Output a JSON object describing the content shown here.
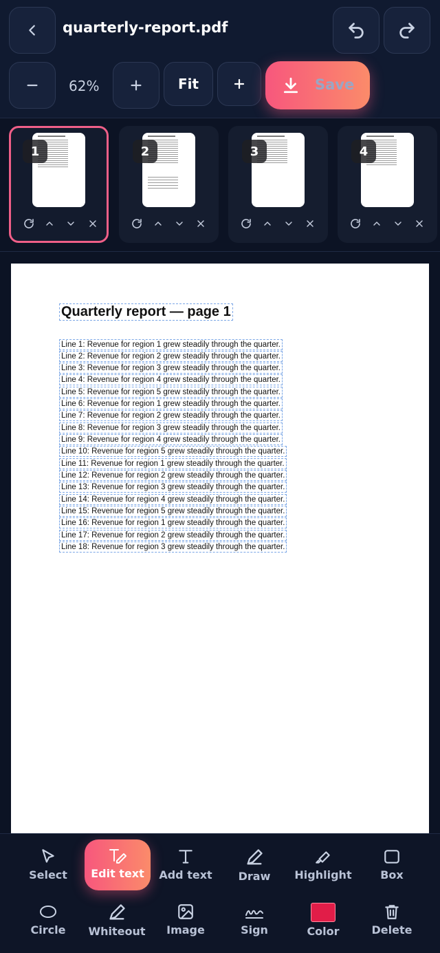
{
  "header": {
    "title": "quarterly-report.pdf",
    "zoom": "62%",
    "fit_label": "Fit",
    "save_label": "Save"
  },
  "pages": [
    {
      "number": "1",
      "selected": true
    },
    {
      "number": "2",
      "selected": false
    },
    {
      "number": "3",
      "selected": false
    },
    {
      "number": "4",
      "selected": false
    }
  ],
  "document": {
    "title": "Quarterly report — page 1",
    "lines": [
      "Line 1: Revenue for region 1 grew steadily through the quarter.",
      "Line 2: Revenue for region 2 grew steadily through the quarter.",
      "Line 3: Revenue for region 3 grew steadily through the quarter.",
      "Line 4: Revenue for region 4 grew steadily through the quarter.",
      "Line 5: Revenue for region 5 grew steadily through the quarter.",
      "Line 6: Revenue for region 1 grew steadily through the quarter.",
      "Line 7: Revenue for region 2 grew steadily through the quarter.",
      "Line 8: Revenue for region 3 grew steadily through the quarter.",
      "Line 9: Revenue for region 4 grew steadily through the quarter.",
      "Line 10: Revenue for region 5 grew steadily through the quarter.",
      "Line 11: Revenue for region 1 grew steadily through the quarter.",
      "Line 12: Revenue for region 2 grew steadily through the quarter.",
      "Line 13: Revenue for region 3 grew steadily through the quarter.",
      "Line 14: Revenue for region 4 grew steadily through the quarter.",
      "Line 15: Revenue for region 5 grew steadily through the quarter.",
      "Line 16: Revenue for region 1 grew steadily through the quarter.",
      "Line 17: Revenue for region 2 grew steadily through the quarter.",
      "Line 18: Revenue for region 3 grew steadily through the quarter."
    ]
  },
  "tools": {
    "select": "Select",
    "edit_text": "Edit text",
    "add_text": "Add text",
    "draw": "Draw",
    "highlight": "Highlight",
    "box": "Box",
    "circle": "Circle",
    "whiteout": "Whiteout",
    "image": "Image",
    "sign": "Sign",
    "color": "Color",
    "delete": "Delete",
    "active": "edit_text",
    "color_value": "#e11d48"
  },
  "colors": {
    "accent_start": "#f7577d",
    "accent_end": "#fb8b6a",
    "selection": "#ef5f88",
    "background": "#0e1527"
  }
}
